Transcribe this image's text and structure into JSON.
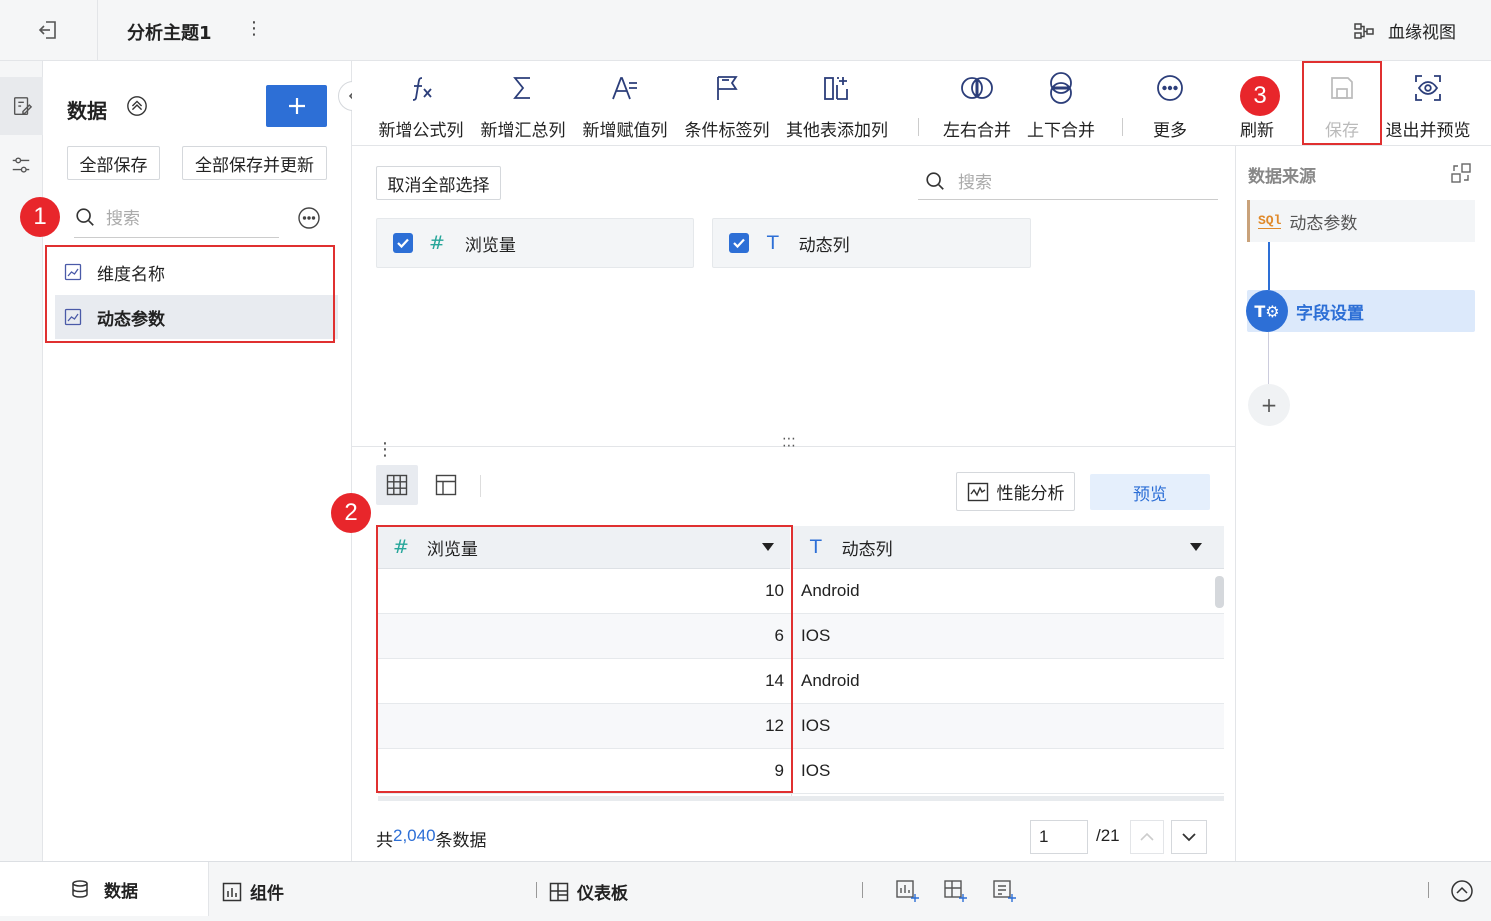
{
  "header": {
    "title": "分析主题1",
    "lineage_label": "血缘视图"
  },
  "left_panel": {
    "title": "数据",
    "save_all": "全部保存",
    "save_all_update": "全部保存并更新",
    "search_placeholder": "搜索",
    "items": [
      {
        "label": "维度名称",
        "selected": false
      },
      {
        "label": "动态参数",
        "selected": true
      }
    ]
  },
  "badges": [
    "1",
    "2",
    "3"
  ],
  "toolbar": {
    "items": [
      {
        "label": "新增公式列",
        "icon": "formula-icon"
      },
      {
        "label": "新增汇总列",
        "icon": "sigma-icon"
      },
      {
        "label": "新增赋值列",
        "icon": "assign-icon"
      },
      {
        "label": "条件标签列",
        "icon": "flag-icon"
      },
      {
        "label": "其他表添加列",
        "icon": "add-column-icon"
      },
      {
        "label": "左右合并",
        "icon": "merge-lr-icon"
      },
      {
        "label": "上下合并",
        "icon": "merge-tb-icon"
      },
      {
        "label": "更多",
        "icon": "more-icon"
      },
      {
        "label": "刷新",
        "icon": "refresh-icon"
      },
      {
        "label": "保存",
        "icon": "save-icon"
      },
      {
        "label": "退出并预览",
        "icon": "preview-eye-icon"
      }
    ]
  },
  "fields": {
    "deselect_all": "取消全部选择",
    "search_placeholder": "搜索",
    "items": [
      {
        "label": "浏览量",
        "type_icon": "#",
        "checked": true
      },
      {
        "label": "动态列",
        "type_icon": "T",
        "checked": true
      }
    ]
  },
  "preview": {
    "perf_label": "性能分析",
    "preview_label": "预览",
    "columns": [
      {
        "label": "浏览量",
        "type_icon": "#"
      },
      {
        "label": "动态列",
        "type_icon": "T"
      }
    ],
    "rows": [
      [
        "10",
        "Android"
      ],
      [
        "6",
        "IOS"
      ],
      [
        "14",
        "Android"
      ],
      [
        "12",
        "IOS"
      ],
      [
        "9",
        "IOS"
      ]
    ],
    "total_prefix": "共",
    "total_count": "2,040",
    "total_suffix": "条数据",
    "page_value": "1",
    "page_total": "/21"
  },
  "right_panel": {
    "title": "数据来源",
    "source_label": "动态参数",
    "step_label": "字段设置",
    "add_label": "+"
  },
  "bottom_bar": {
    "tabs": [
      {
        "label": "数据",
        "active": true
      },
      {
        "label": "组件",
        "active": false
      },
      {
        "label": "仪表板",
        "active": false
      }
    ]
  },
  "colors": {
    "accent": "#2d6fd6",
    "highlight_box": "#e03030",
    "badge": "#e8262b",
    "number_type": "#26a69a",
    "total_count": "#2d6fd6"
  }
}
